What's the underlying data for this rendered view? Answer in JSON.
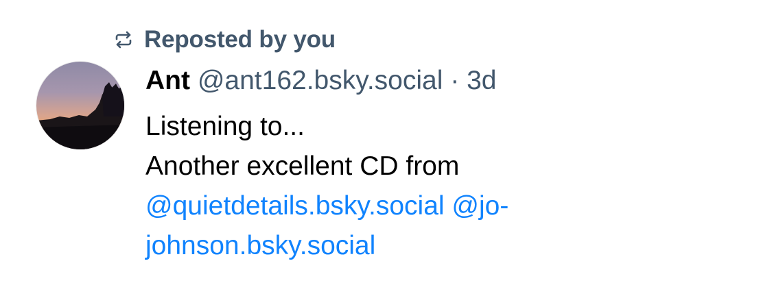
{
  "repost": {
    "icon": "repost-icon",
    "label": "Reposted by you"
  },
  "post": {
    "avatar": {
      "description_icon": "avatar-sunset"
    },
    "author": {
      "display_name": "Ant",
      "handle": "@ant162.bsky.social",
      "separator": "·",
      "time": "3d"
    },
    "text": {
      "line1": "Listening to...",
      "line2": "Another excellent CD from",
      "mention1": "@quietdetails.bsky.social",
      "mention2_part1": "@jo-",
      "mention2_part2": "johnson.bsky.social"
    }
  },
  "colors": {
    "muted": "#42576c",
    "link": "#1083fe",
    "text": "#000000"
  }
}
